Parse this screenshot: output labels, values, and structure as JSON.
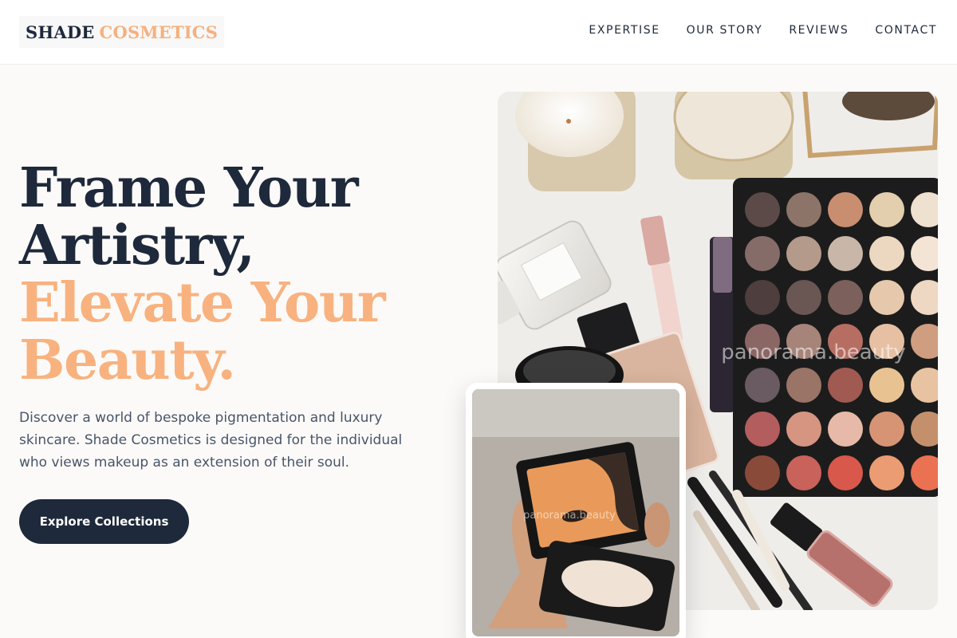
{
  "brand": {
    "name_part1": "SHADE",
    "name_part2": "COSMETICS"
  },
  "nav": {
    "items": [
      "EXPERTISE",
      "OUR STORY",
      "REVIEWS",
      "CONTACT"
    ]
  },
  "hero": {
    "headline_line1": "Frame Your",
    "headline_line2": "Artistry,",
    "headline_line3": "Elevate Your",
    "headline_line4": "Beauty.",
    "description": "Discover a world of bespoke pigmentation and luxury skincare. Shade Cosmetics is designed for the individual who views makeup as an extension of their soul.",
    "cta_label": "Explore Collections"
  },
  "images": {
    "main_watermark": "panorama.beauty",
    "inset_watermark": "panorama.beauty"
  },
  "colors": {
    "dark": "#1e293b",
    "accent": "#f8b27f",
    "background": "#fcfaf8"
  }
}
